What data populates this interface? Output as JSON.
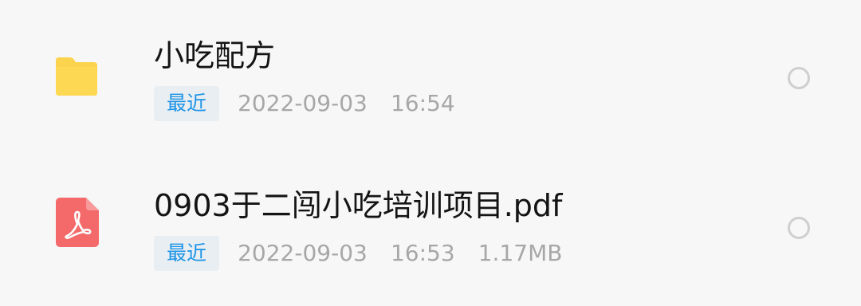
{
  "files": [
    {
      "name": "小吃配方",
      "badge": "最近",
      "date": "2022-09-03",
      "time": "16:54",
      "size": "",
      "icon": "folder-icon",
      "icon_color": "#fcd34d"
    },
    {
      "name": "0903于二闯小吃培训项目.pdf",
      "badge": "最近",
      "date": "2022-09-03",
      "time": "16:53",
      "size": "1.17MB",
      "icon": "pdf-icon",
      "icon_color": "#f46a6a"
    }
  ],
  "colors": {
    "badge_text": "#1d94e6",
    "badge_bg": "#e9eef3",
    "name_text": "#141414",
    "meta_text": "#a7a7a7",
    "radio_border": "#cfcfcf"
  }
}
